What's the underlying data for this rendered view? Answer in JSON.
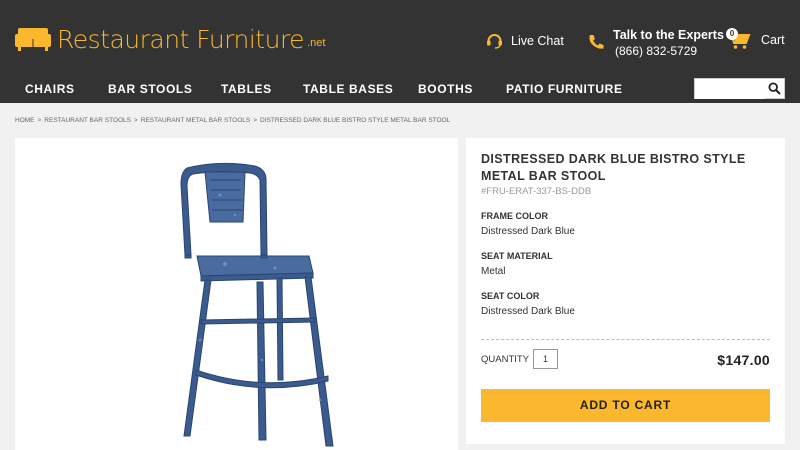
{
  "brand": {
    "name": "Restaurant Furniture",
    "tld": ".net",
    "accent": "#fbb82e"
  },
  "header": {
    "live_chat": "Live Chat",
    "experts_title": "Talk to the Experts",
    "experts_phone": "(866) 832-5729",
    "cart_label": "Cart",
    "cart_count": "0"
  },
  "nav": {
    "items": [
      "CHAIRS",
      "BAR STOOLS",
      "TABLES",
      "TABLE BASES",
      "BOOTHS",
      "PATIO FURNITURE"
    ],
    "search_placeholder": ""
  },
  "breadcrumb": [
    "HOME",
    "RESTAURANT BAR STOOLS",
    "RESTAURANT METAL BAR STOOLS",
    "DISTRESSED DARK BLUE BISTRO STYLE METAL BAR STOOL"
  ],
  "product": {
    "title": "DISTRESSED DARK BLUE BISTRO STYLE METAL BAR STOOL",
    "sku": "#FRU-ERAT-337-BS-DDB",
    "specs": [
      {
        "label": "FRAME COLOR",
        "value": "Distressed Dark Blue"
      },
      {
        "label": "SEAT MATERIAL",
        "value": "Metal"
      },
      {
        "label": "SEAT COLOR",
        "value": "Distressed Dark Blue"
      }
    ],
    "quantity_label": "QUANTITY",
    "quantity_value": "1",
    "price": "$147.00",
    "add_to_cart": "ADD TO CART",
    "stool_color": "#3b5b8e"
  }
}
